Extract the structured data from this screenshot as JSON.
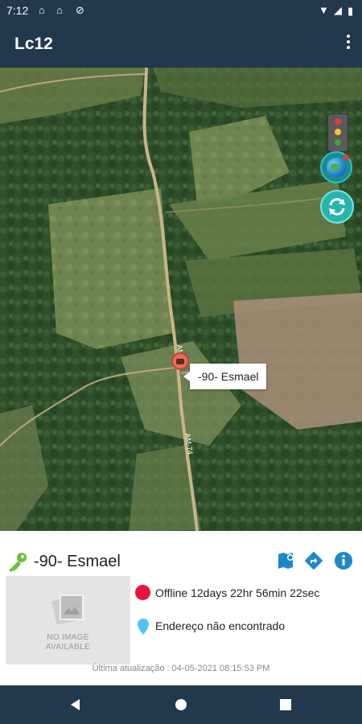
{
  "status_bar": {
    "time": "7:12"
  },
  "app_bar": {
    "title": "Lc12"
  },
  "map": {
    "marker_label": "-90- Esmael",
    "road_label_1": "AM-74",
    "road_label_2": "AM-74",
    "traffic_light_colors": [
      "#e53935",
      "#fbc02d",
      "#43a047"
    ]
  },
  "vehicle_panel": {
    "name": "-90- Esmael",
    "no_image_text_1": "NO IMAGE",
    "no_image_text_2": "AVAILABLE",
    "status": "Offline 12days 22hr 56min 22sec",
    "status_color": "#e8123a",
    "address": "Endereço não encontrado",
    "last_update": "Última atualização : 04-05-2021 08:15:53 PM"
  },
  "colors": {
    "primary": "#22384c",
    "accent_green": "#6cbf3c",
    "icon_blue": "#1e88c7",
    "teal": "#26b5b0"
  }
}
